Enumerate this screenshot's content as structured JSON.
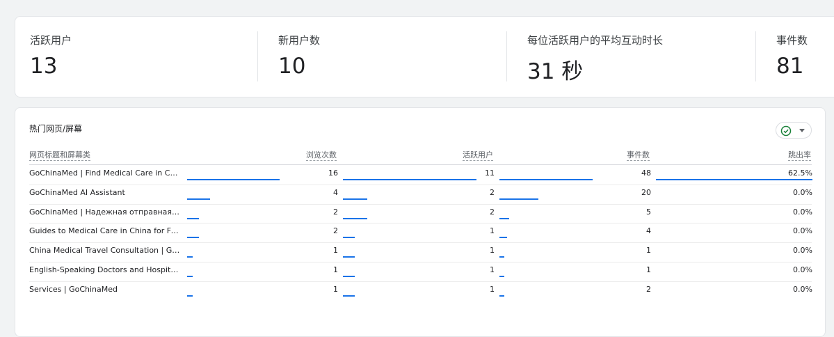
{
  "summary": [
    {
      "label": "活跃用户",
      "value": "13"
    },
    {
      "label": "新用户数",
      "value": "10"
    },
    {
      "label": "每位活跃用户的平均互动时长",
      "value": "31 秒"
    },
    {
      "label": "事件数",
      "value": "81"
    }
  ],
  "table": {
    "title": "热门网页/屏幕",
    "compare_icon": "check-circle-icon",
    "columns": [
      "网页标题和屏幕类",
      "浏览次数",
      "活跃用户",
      "事件数",
      "跳出率"
    ],
    "bar_max": {
      "views": 16,
      "users": 11,
      "events": 48,
      "bounce": 62.5
    },
    "bar_color": "#1a73e8",
    "rows": [
      {
        "title": "GoChinaMed | Find Medical Care in China...",
        "views": "16",
        "users": "11",
        "events": "48",
        "bounce": "62.5%",
        "views_n": 16,
        "users_n": 11,
        "events_n": 48,
        "bounce_n": 62.5
      },
      {
        "title": "GoChinaMed AI Assistant",
        "views": "4",
        "users": "2",
        "events": "20",
        "bounce": "0.0%",
        "views_n": 4,
        "users_n": 2,
        "events_n": 20,
        "bounce_n": 0
      },
      {
        "title": "GoChinaMed | Надежная отправная точ...",
        "views": "2",
        "users": "2",
        "events": "5",
        "bounce": "0.0%",
        "views_n": 2,
        "users_n": 2,
        "events_n": 5,
        "bounce_n": 0
      },
      {
        "title": "Guides to Medical Care in China for Forei...",
        "views": "2",
        "users": "1",
        "events": "4",
        "bounce": "0.0%",
        "views_n": 2,
        "users_n": 1,
        "events_n": 4,
        "bounce_n": 0
      },
      {
        "title": "China Medical Travel Consultation | GoCh...",
        "views": "1",
        "users": "1",
        "events": "1",
        "bounce": "0.0%",
        "views_n": 1,
        "users_n": 1,
        "events_n": 1,
        "bounce_n": 0
      },
      {
        "title": "English-Speaking Doctors and Hospitals i...",
        "views": "1",
        "users": "1",
        "events": "1",
        "bounce": "0.0%",
        "views_n": 1,
        "users_n": 1,
        "events_n": 1,
        "bounce_n": 0
      },
      {
        "title": "Services | GoChinaMed",
        "views": "1",
        "users": "1",
        "events": "2",
        "bounce": "0.0%",
        "views_n": 1,
        "users_n": 1,
        "events_n": 2,
        "bounce_n": 0
      }
    ]
  }
}
